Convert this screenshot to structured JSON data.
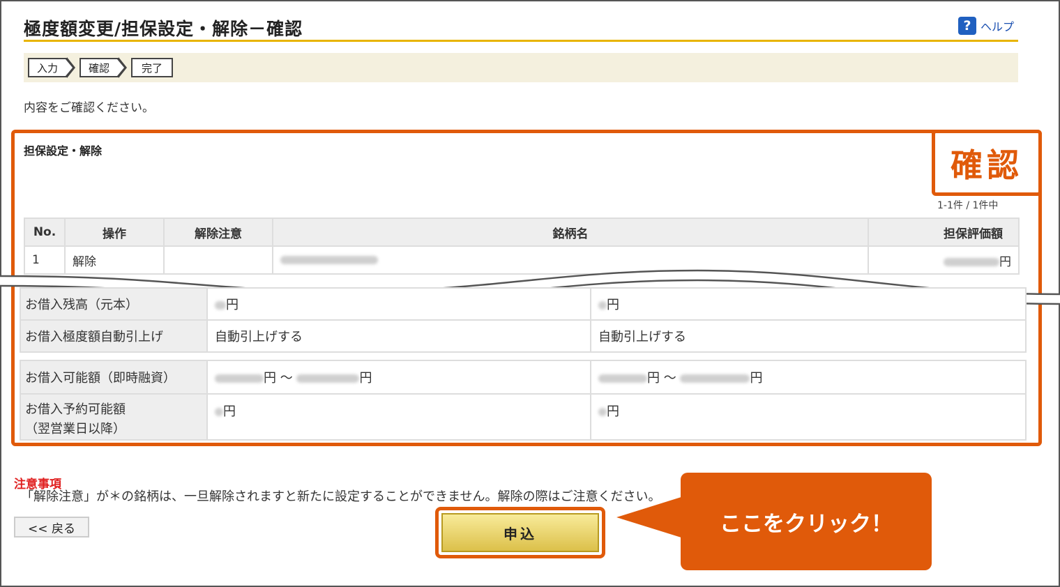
{
  "header": {
    "title": "極度額変更/担保設定・解除－確認",
    "help_label": "ヘルプ"
  },
  "steps": [
    "入力",
    "確認",
    "完了"
  ],
  "intro_text": "内容をご確認ください。",
  "section": {
    "title": "担保設定・解除",
    "badge": "確認",
    "count_text": "1-1件 / 1件中"
  },
  "table": {
    "headers": [
      "No.",
      "操作",
      "解除注意",
      "銘柄名",
      "担保評価額"
    ],
    "rows": [
      {
        "no": "1",
        "op": "解除",
        "caution": "",
        "amount_unit": "円"
      }
    ]
  },
  "details": {
    "outstanding_label": "お借入残高（元本）",
    "outstanding_before": "円",
    "outstanding_after": "円",
    "auto_raise_label": "お借入極度額自動引上げ",
    "auto_raise_before": "自動引上げする",
    "auto_raise_after": "自動引上げする",
    "available_label": "お借入可能額（即時融資）",
    "available_before_min": "円",
    "available_before_sep": "～",
    "available_before_max": "円",
    "available_after_min": "円",
    "available_after_sep": "～",
    "available_after_max": "円",
    "reserve_label_1": "お借入予約可能額",
    "reserve_label_2": "（翌営業日以降）",
    "reserve_before": "円",
    "reserve_after": "円"
  },
  "notes": {
    "title": "注意事項",
    "text": "「解除注意」が＊の銘柄は、一旦解除されますと新たに設定することができません。解除の際はご注意ください。"
  },
  "buttons": {
    "back": "<< 戻る",
    "submit": "申込"
  },
  "callout": "ここをクリック！",
  "colors": {
    "accent": "#e05a0a",
    "title_rule": "#e8b400",
    "help_icon": "#2060c0",
    "notes_title": "#e02020"
  }
}
